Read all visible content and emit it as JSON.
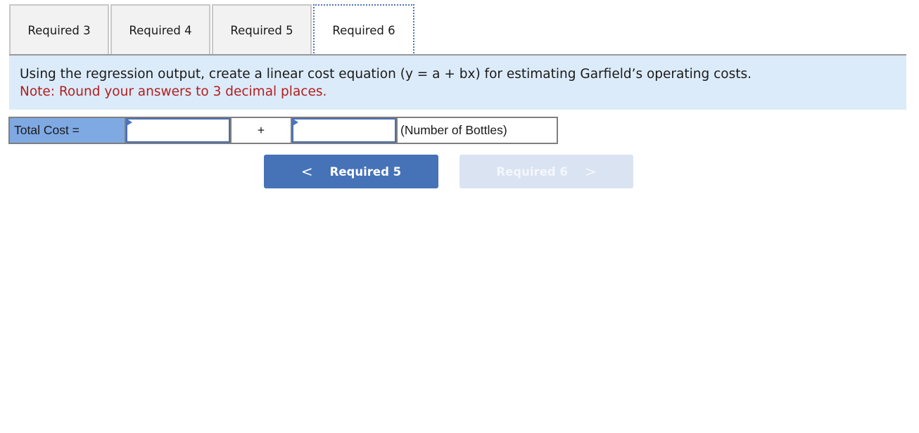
{
  "tabs": [
    {
      "label": "Required 3",
      "active": false
    },
    {
      "label": "Required 4",
      "active": false
    },
    {
      "label": "Required 5",
      "active": false
    },
    {
      "label": "Required 6",
      "active": true
    }
  ],
  "instructions": {
    "question": "Using the regression output, create a linear cost equation (y = a + bx) for estimating Garfield’s operating costs.",
    "note": "Note: Round your answers to 3 decimal places."
  },
  "equation": {
    "label": "Total Cost =",
    "intercept_value": "",
    "plus_sign": "+",
    "slope_value": "",
    "unit_label": "(Number of Bottles)"
  },
  "navigation": {
    "prev": {
      "label": "Required 5",
      "icon": "chevron-left-icon",
      "glyph": "<"
    },
    "next": {
      "label": "Required 6",
      "icon": "chevron-right-icon",
      "glyph": ">",
      "disabled": true
    }
  },
  "colors": {
    "accent": "#4672b8",
    "label_cell": "#7fa9e3",
    "instructions_bg": "#dcebf9",
    "note_text": "#b21e1e",
    "disabled_button": "#dae3f2"
  }
}
